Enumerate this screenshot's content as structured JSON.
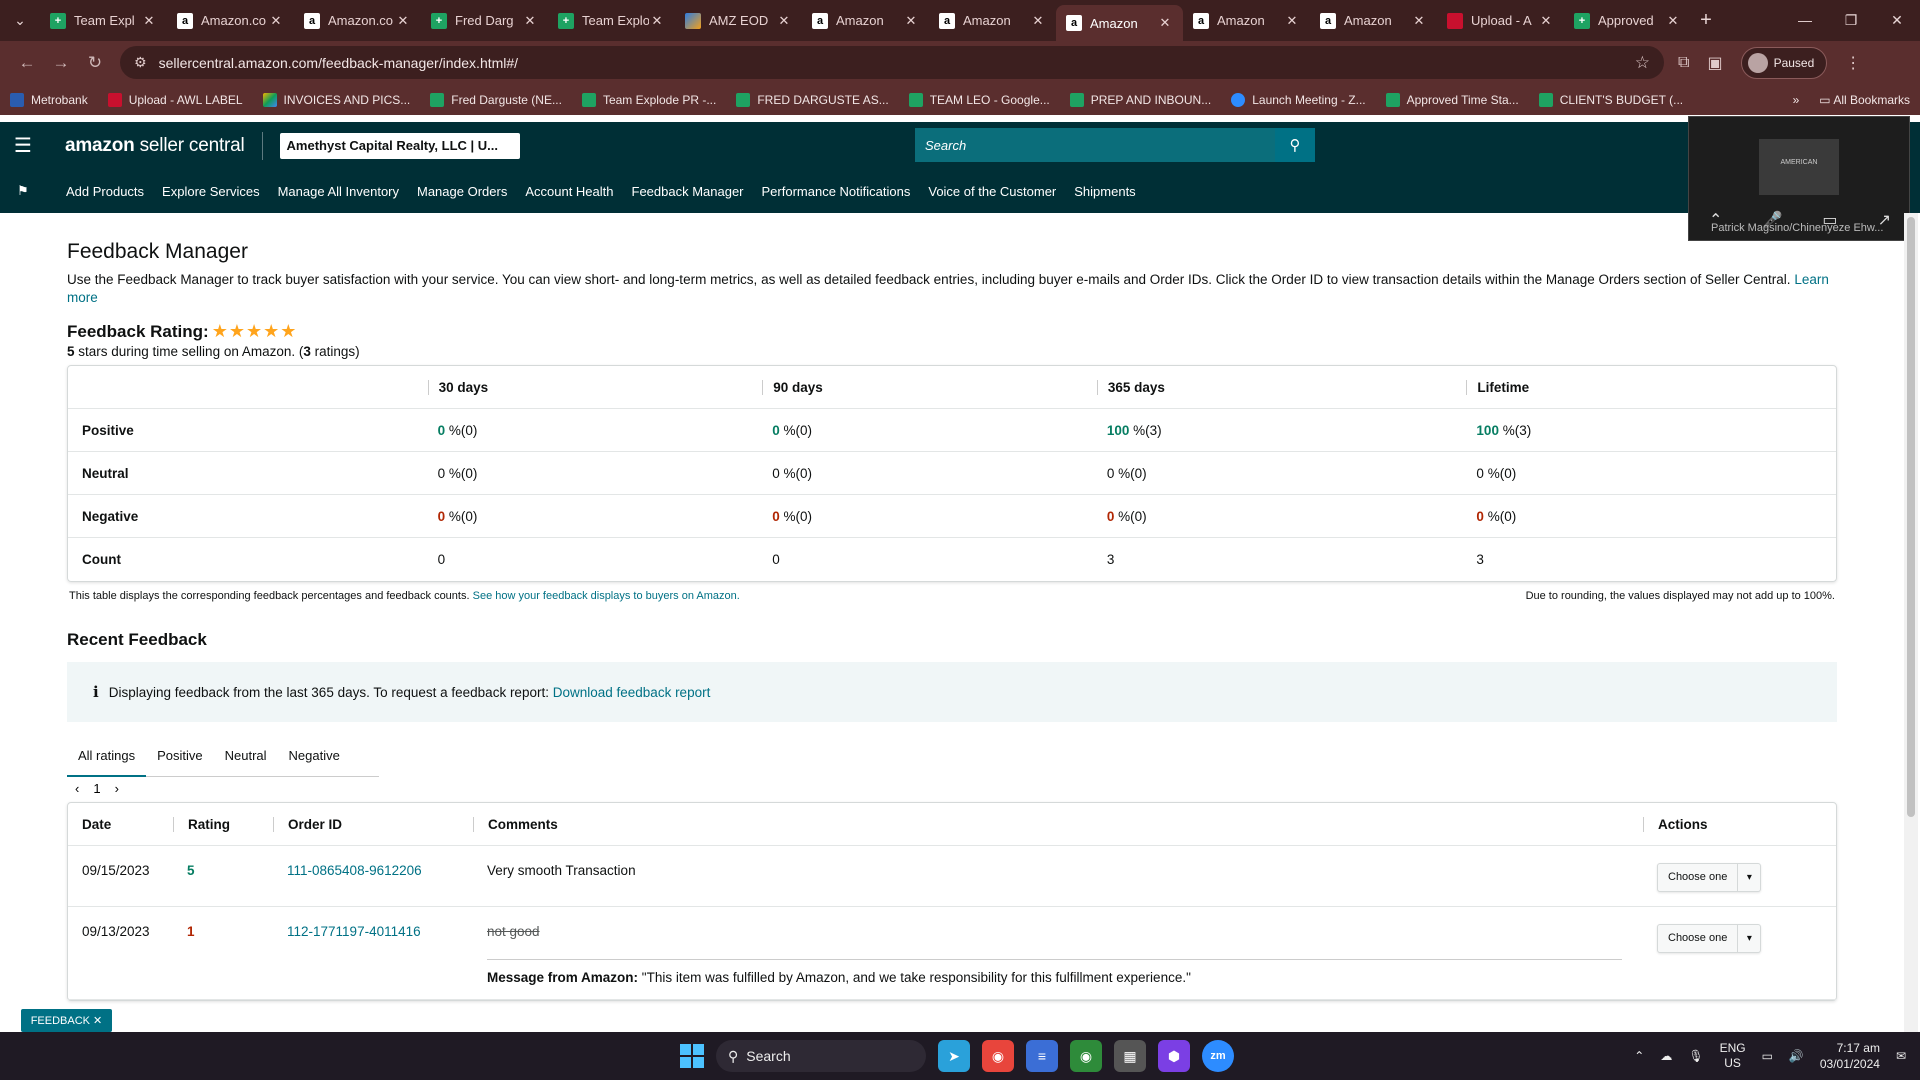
{
  "browser": {
    "tabs": [
      {
        "label": "Team Expl",
        "icon": "sheets-icon",
        "active": false
      },
      {
        "label": "Amazon.co",
        "icon": "amazon-icon",
        "active": false
      },
      {
        "label": "Amazon.co",
        "icon": "amazon-icon",
        "active": false
      },
      {
        "label": "Fred Darg",
        "icon": "sheets-icon",
        "active": false
      },
      {
        "label": "Team Explo",
        "icon": "sheets-icon",
        "active": false
      },
      {
        "label": "AMZ EOD",
        "icon": "multi-icon",
        "active": false
      },
      {
        "label": "Amazon",
        "icon": "amazon-icon",
        "active": false
      },
      {
        "label": "Amazon",
        "icon": "amazon-icon",
        "active": false
      },
      {
        "label": "Amazon",
        "icon": "amazon-icon",
        "active": true
      },
      {
        "label": "Amazon",
        "icon": "amazon-icon",
        "active": false
      },
      {
        "label": "Amazon",
        "icon": "amazon-icon",
        "active": false
      },
      {
        "label": "Upload - A",
        "icon": "upload-icon",
        "active": false
      },
      {
        "label": "Approved",
        "icon": "sheets-icon",
        "active": false
      }
    ],
    "url": "sellercentral.amazon.com/feedback-manager/index.html#/",
    "profile_status": "Paused",
    "bookmarks": [
      {
        "label": "Metrobank",
        "icon": "bank"
      },
      {
        "label": "Upload - AWL LABEL",
        "icon": "upload"
      },
      {
        "label": "INVOICES AND PICS...",
        "icon": "drive"
      },
      {
        "label": "Fred Darguste (NE...",
        "icon": "sheets"
      },
      {
        "label": "Team Explode PR -...",
        "icon": "sheets"
      },
      {
        "label": "FRED DARGUSTE AS...",
        "icon": "sheets"
      },
      {
        "label": "TEAM LEO - Google...",
        "icon": "sheets"
      },
      {
        "label": "PREP AND INBOUN...",
        "icon": "sheets"
      },
      {
        "label": "Launch Meeting - Z...",
        "icon": "zoom"
      },
      {
        "label": "Approved Time Sta...",
        "icon": "sheets"
      },
      {
        "label": "CLIENT'S BUDGET (...",
        "icon": "sheets"
      }
    ],
    "all_bookmarks": "All Bookmarks"
  },
  "seller": {
    "logo_bold": "amazon",
    "logo_rest": " seller central",
    "account": "Amethyst Capital Realty, LLC | U...",
    "search_placeholder": "Search",
    "nav": [
      "Add Products",
      "Explore Services",
      "Manage All Inventory",
      "Manage Orders",
      "Account Health",
      "Feedback Manager",
      "Performance Notifications",
      "Voice of the Customer",
      "Shipments"
    ]
  },
  "zoom_overlay": {
    "participant": "Patrick Magsino/Chinenyeze Ehw...",
    "video_text": "AMERICAN"
  },
  "page": {
    "title": "Feedback Manager",
    "description": "Use the Feedback Manager to track buyer satisfaction with your service. You can view short- and long-term metrics, as well as detailed feedback entries, including buyer e-mails and Order IDs. Click the Order ID to view transaction details within the Manage Orders section of Seller Central.",
    "learn_more": "Learn more",
    "rating_label": "Feedback Rating:",
    "rating_stars": 5,
    "rating_sub_pre": "5",
    "rating_sub_mid": " stars during time selling on Amazon. (",
    "rating_sub_count": "3",
    "rating_sub_post": " ratings)",
    "table_columns": [
      "",
      "30 days",
      "90 days",
      "365 days",
      "Lifetime"
    ],
    "table_rows": [
      {
        "label": "Positive",
        "cells": [
          [
            "0",
            "%(0)",
            "g"
          ],
          [
            "0",
            "%(0)",
            "g"
          ],
          [
            "100",
            "%(3)",
            "g"
          ],
          [
            "100",
            "%(3)",
            "g"
          ]
        ]
      },
      {
        "label": "Neutral",
        "cells": [
          [
            "0",
            "%(0)",
            ""
          ],
          [
            "0",
            "%(0)",
            ""
          ],
          [
            "0",
            "%(0)",
            ""
          ],
          [
            "0",
            "%(0)",
            ""
          ]
        ]
      },
      {
        "label": "Negative",
        "cells": [
          [
            "0",
            "%(0)",
            "r"
          ],
          [
            "0",
            "%(0)",
            "r"
          ],
          [
            "0",
            "%(0)",
            "r"
          ],
          [
            "0",
            "%(0)",
            "r"
          ]
        ]
      },
      {
        "label": "Count",
        "cells": [
          [
            "0",
            "",
            ""
          ],
          [
            "0",
            "",
            ""
          ],
          [
            "3",
            "",
            ""
          ],
          [
            "3",
            "",
            ""
          ]
        ]
      }
    ],
    "table_note": "This table displays the corresponding feedback percentages and feedback counts.",
    "table_note_link": "See how your feedback displays to buyers on Amazon.",
    "rounding_note": "Due to rounding, the values displayed may not add up to 100%.",
    "recent_title": "Recent Feedback",
    "info_text": "Displaying feedback from the last 365 days. To request a feedback report:",
    "info_link": "Download feedback report",
    "rating_tabs": [
      "All ratings",
      "Positive",
      "Neutral",
      "Negative"
    ],
    "page_number": "1",
    "recent_columns": [
      "Date",
      "Rating",
      "Order ID",
      "Comments",
      "Actions"
    ],
    "recent_rows": [
      {
        "date": "09/15/2023",
        "rating": "5",
        "rating_color": "g",
        "order_id": "111-0865408-9612206",
        "comment": "Very smooth Transaction",
        "struck": false,
        "action": "Choose one"
      },
      {
        "date": "09/13/2023",
        "rating": "1",
        "rating_color": "r",
        "order_id": "112-1771197-4011416",
        "comment": "not good",
        "struck": true,
        "action": "Choose one",
        "amazon_msg_label": "Message from Amazon:",
        "amazon_msg": "\"This item was fulfilled by Amazon, and we take responsibility for this fulfillment experience.\""
      }
    ],
    "feedback_button": "FEEDBACK"
  },
  "taskbar": {
    "search": "Search",
    "lang_top": "ENG",
    "lang_bottom": "US",
    "time": "7:17 am",
    "date": "03/01/2024"
  }
}
